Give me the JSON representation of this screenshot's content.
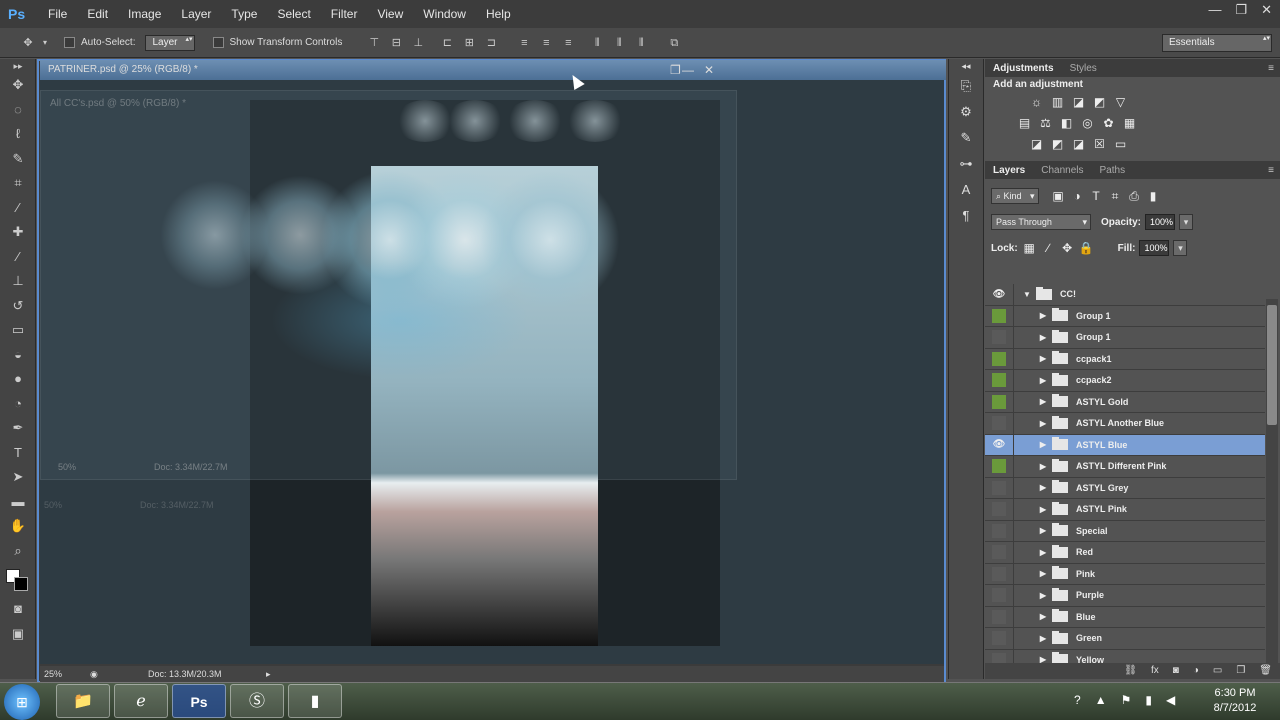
{
  "app": {
    "logo": "Ps"
  },
  "menubar": {
    "items": [
      "File",
      "Edit",
      "Image",
      "Layer",
      "Type",
      "Select",
      "Filter",
      "View",
      "Window",
      "Help"
    ]
  },
  "window_controls": {
    "minimize": "—",
    "restore": "❐",
    "close": "✕"
  },
  "options_bar": {
    "tool_icon": "move-tool-icon",
    "auto_select_label": "Auto-Select:",
    "auto_select_target": "Layer",
    "show_transform_label": "Show Transform Controls",
    "workspace": "Essentials"
  },
  "document": {
    "title": "PATRINER.psd @ 25% (RGB/8) *",
    "zoom": "25%",
    "doc_size": "Doc: 13.3M/20.3M"
  },
  "inner_document": {
    "title": "All CC's.psd @ 50% (RGB/8) *",
    "zoom": "50%",
    "doc_size": "Doc: 3.34M/22.7M"
  },
  "ghost_document": {
    "zoom": "50%",
    "doc_size": "Doc: 3.34M/22.7M"
  },
  "panels": {
    "adjustments_tabs": [
      "Adjustments",
      "Styles"
    ],
    "add_adjustment": "Add an adjustment",
    "layers_tabs": [
      "Layers",
      "Channels",
      "Paths"
    ],
    "kind": "Kind",
    "blend_mode": "Pass Through",
    "opacity_label": "Opacity:",
    "opacity_value": "100%",
    "lock_label": "Lock:",
    "fill_label": "Fill:",
    "fill_value": "100%"
  },
  "layers": [
    {
      "name": "CC!",
      "type": "top",
      "vis": "eye"
    },
    {
      "name": "Group 1",
      "vis": "green"
    },
    {
      "name": "Group 1",
      "vis": "gray"
    },
    {
      "name": "ccpack1",
      "vis": "green"
    },
    {
      "name": "ccpack2",
      "vis": "green"
    },
    {
      "name": "ASTYL Gold",
      "vis": "green"
    },
    {
      "name": "ASTYL Another Blue",
      "vis": "gray"
    },
    {
      "name": "ASTYL Blue",
      "vis": "eye",
      "selected": true
    },
    {
      "name": "ASTYL Different Pink",
      "vis": "green"
    },
    {
      "name": "ASTYL Grey",
      "vis": "gray"
    },
    {
      "name": "ASTYL Pink",
      "vis": "gray"
    },
    {
      "name": "Special",
      "vis": "gray"
    },
    {
      "name": "Red",
      "vis": "gray"
    },
    {
      "name": "Pink",
      "vis": "gray"
    },
    {
      "name": "Purple",
      "vis": "gray"
    },
    {
      "name": "Blue",
      "vis": "gray"
    },
    {
      "name": "Green",
      "vis": "gray"
    },
    {
      "name": "Yellow",
      "vis": "gray"
    }
  ],
  "taskbar": {
    "time": "6:30 PM",
    "date": "8/7/2012"
  }
}
